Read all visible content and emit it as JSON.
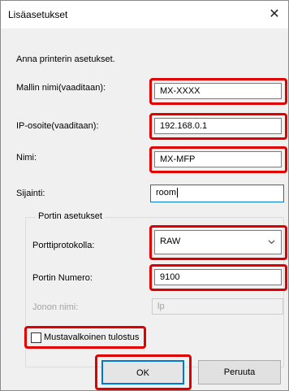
{
  "window": {
    "title": "Lisäasetukset",
    "close_glyph": "✕"
  },
  "instruction": "Anna printerin asetukset.",
  "fields": {
    "model": {
      "label": "Mallin nimi(vaaditaan):",
      "value": "MX-XXXX"
    },
    "ip": {
      "label": "IP-osoite(vaaditaan):",
      "value": "192.168.0.1"
    },
    "name": {
      "label": "Nimi:",
      "value": "MX-MFP"
    },
    "location": {
      "label": "Sijainti:",
      "value": "room"
    }
  },
  "port_group": {
    "title": "Portin asetukset",
    "protocol": {
      "label": "Porttiprotokolla:",
      "value": "RAW"
    },
    "port_number": {
      "label": "Portin Numero:",
      "value": "9100"
    },
    "queue": {
      "label": "Jonon nimi:",
      "value": "lp"
    }
  },
  "checkbox": {
    "label": "Mustavalkoinen tulostus",
    "checked": false
  },
  "buttons": {
    "ok": "OK",
    "cancel": "Peruuta"
  },
  "colors": {
    "highlight": "#e00000",
    "focus": "#0078d7",
    "disabled_text": "#a3a3a3"
  }
}
